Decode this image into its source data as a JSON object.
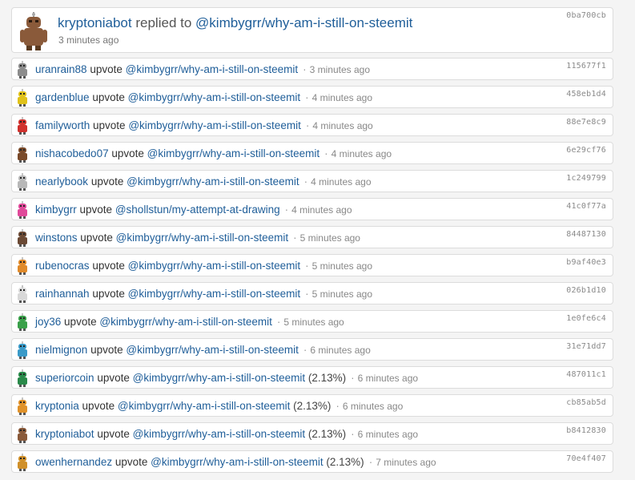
{
  "top": {
    "user": "kryptoniabot",
    "verb": "replied to",
    "link": "@kimbygrr/why-am-i-still-on-steemit",
    "time": "3 minutes ago",
    "hash": "0ba700cb",
    "avatar_color": "#8a5a3a"
  },
  "rows": [
    {
      "user": "uranrain88",
      "verb": "upvote",
      "link": "@kimbygrr/why-am-i-still-on-steemit",
      "pct": "",
      "time": "3 minutes ago",
      "hash": "115677f1",
      "avatar_color": "#8c8c8c"
    },
    {
      "user": "gardenblue",
      "verb": "upvote",
      "link": "@kimbygrr/why-am-i-still-on-steemit",
      "pct": "",
      "time": "4 minutes ago",
      "hash": "458eb1d4",
      "avatar_color": "#e0c21a"
    },
    {
      "user": "familyworth",
      "verb": "upvote",
      "link": "@kimbygrr/why-am-i-still-on-steemit",
      "pct": "",
      "time": "4 minutes ago",
      "hash": "88e7e8c9",
      "avatar_color": "#d0312d"
    },
    {
      "user": "nishacobedo07",
      "verb": "upvote",
      "link": "@kimbygrr/why-am-i-still-on-steemit",
      "pct": "",
      "time": "4 minutes ago",
      "hash": "6e29cf76",
      "avatar_color": "#7a4a2a"
    },
    {
      "user": "nearlybook",
      "verb": "upvote",
      "link": "@kimbygrr/why-am-i-still-on-steemit",
      "pct": "",
      "time": "4 minutes ago",
      "hash": "1c249799",
      "avatar_color": "#b8b8b8"
    },
    {
      "user": "kimbygrr",
      "verb": "upvote",
      "link": "@shollstun/my-attempt-at-drawing",
      "pct": "",
      "time": "4 minutes ago",
      "hash": "41c0f77a",
      "avatar_color": "#e04a9a"
    },
    {
      "user": "winstons",
      "verb": "upvote",
      "link": "@kimbygrr/why-am-i-still-on-steemit",
      "pct": "",
      "time": "5 minutes ago",
      "hash": "84487130",
      "avatar_color": "#6b4a35"
    },
    {
      "user": "rubenocras",
      "verb": "upvote",
      "link": "@kimbygrr/why-am-i-still-on-steemit",
      "pct": "",
      "time": "5 minutes ago",
      "hash": "b9af40e3",
      "avatar_color": "#e08a2a"
    },
    {
      "user": "rainhannah",
      "verb": "upvote",
      "link": "@kimbygrr/why-am-i-still-on-steemit",
      "pct": "",
      "time": "5 minutes ago",
      "hash": "026b1d10",
      "avatar_color": "#d8d8d8"
    },
    {
      "user": "joy36",
      "verb": "upvote",
      "link": "@kimbygrr/why-am-i-still-on-steemit",
      "pct": "",
      "time": "5 minutes ago",
      "hash": "1e0fe6c4",
      "avatar_color": "#3aa04a"
    },
    {
      "user": "nielmignon",
      "verb": "upvote",
      "link": "@kimbygrr/why-am-i-still-on-steemit",
      "pct": "",
      "time": "6 minutes ago",
      "hash": "31e71dd7",
      "avatar_color": "#3a9ac8"
    },
    {
      "user": "superiorcoin",
      "verb": "upvote",
      "link": "@kimbygrr/why-am-i-still-on-steemit",
      "pct": "(2.13%)",
      "time": "6 minutes ago",
      "hash": "487011c1",
      "avatar_color": "#2a8a4a"
    },
    {
      "user": "kryptonia",
      "verb": "upvote",
      "link": "@kimbygrr/why-am-i-still-on-steemit",
      "pct": "(2.13%)",
      "time": "6 minutes ago",
      "hash": "cb85ab5d",
      "avatar_color": "#e0922a"
    },
    {
      "user": "kryptoniabot",
      "verb": "upvote",
      "link": "@kimbygrr/why-am-i-still-on-steemit",
      "pct": "(2.13%)",
      "time": "6 minutes ago",
      "hash": "b8412830",
      "avatar_color": "#8a5a3a"
    },
    {
      "user": "owenhernandez",
      "verb": "upvote",
      "link": "@kimbygrr/why-am-i-still-on-steemit",
      "pct": "(2.13%)",
      "time": "7 minutes ago",
      "hash": "70e4f407",
      "avatar_color": "#d0902a"
    }
  ]
}
